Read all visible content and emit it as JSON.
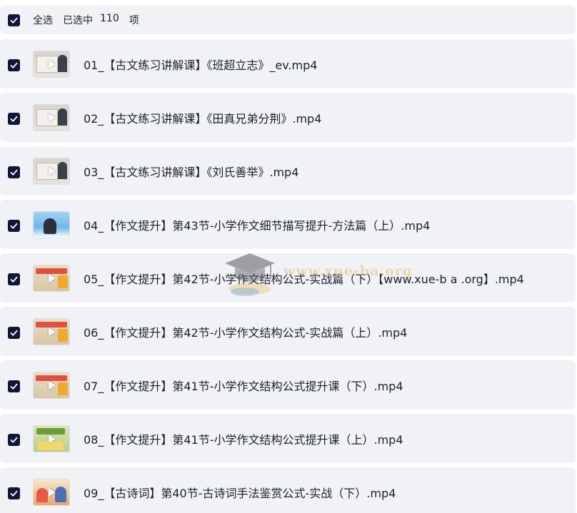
{
  "header": {
    "select_all_label": "全选",
    "selected_label": "已选中",
    "selected_count": "110",
    "unit_label": "项",
    "checked": true
  },
  "files": [
    {
      "name": "01_【古文练习讲解课】《班超立志》_ev.mp4",
      "thumb": "lecture",
      "checked": true
    },
    {
      "name": "02_【古文练习讲解课】《田真兄弟分荆》.mp4",
      "thumb": "lecture",
      "checked": true
    },
    {
      "name": "03_【古文练习讲解课】《刘氏善举》.mp4",
      "thumb": "lecture",
      "checked": true
    },
    {
      "name": "04_【作文提升】第43节-小学作文细节描写提升-方法篇（上）.mp4",
      "thumb": "blue",
      "checked": true
    },
    {
      "name": "05_【作文提升】第42节-小学作文结构公式-实战篇（下）【www.xue-b a .org】.mp4",
      "thumb": "beige",
      "checked": true
    },
    {
      "name": "06_【作文提升】第42节-小学作文结构公式-实战篇（上）.mp4",
      "thumb": "beige",
      "checked": true
    },
    {
      "name": "07_【作文提升】第41节-小学作文结构公式提升课（下）.mp4",
      "thumb": "beige",
      "checked": true
    },
    {
      "name": "08_【作文提升】第41节-小学作文结构公式提升课（上）.mp4",
      "thumb": "green",
      "checked": true
    },
    {
      "name": "09_【古诗词】第40节-古诗词手法鉴赏公式-实战（下）.mp4",
      "thumb": "cartoon",
      "checked": true
    }
  ],
  "watermark": {
    "text": "www.xue-ba.org",
    "icon": "graduation-cap-icon"
  },
  "colors": {
    "checkbox": "#0f1636",
    "row_bg": "#f1f2f6",
    "text": "#1c1f2e"
  }
}
